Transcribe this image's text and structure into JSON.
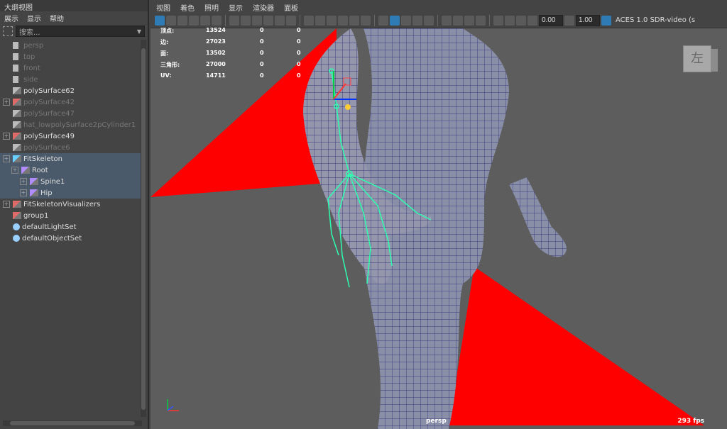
{
  "outliner": {
    "title": "大纲视图",
    "menus": [
      "展示",
      "显示",
      "帮助"
    ],
    "search_placeholder": "搜索...",
    "items": [
      {
        "label": "persp",
        "dim": true,
        "type": "camera",
        "indent": 0,
        "expand": false
      },
      {
        "label": "top",
        "dim": true,
        "type": "camera",
        "indent": 0,
        "expand": false
      },
      {
        "label": "front",
        "dim": true,
        "type": "camera",
        "indent": 0,
        "expand": false
      },
      {
        "label": "side",
        "dim": true,
        "type": "camera",
        "indent": 0,
        "expand": false
      },
      {
        "label": "polySurface62",
        "dim": false,
        "type": "mesh",
        "indent": 0,
        "expand": false
      },
      {
        "label": "polySurface42",
        "dim": true,
        "type": "mesh-group",
        "indent": 0,
        "expand": true
      },
      {
        "label": "polySurface47",
        "dim": true,
        "type": "mesh",
        "indent": 0,
        "expand": false
      },
      {
        "label": "hat_lowpolySurface2pCylinder1",
        "dim": true,
        "type": "mesh",
        "indent": 0,
        "expand": false
      },
      {
        "label": "polySurface49",
        "dim": false,
        "type": "mesh-group",
        "indent": 0,
        "expand": true
      },
      {
        "label": "polySurface6",
        "dim": true,
        "type": "mesh",
        "indent": 0,
        "expand": false
      },
      {
        "label": "FitSkeleton",
        "dim": false,
        "type": "curve",
        "indent": 0,
        "expand": true,
        "selected": true
      },
      {
        "label": "Root",
        "dim": false,
        "type": "joint",
        "indent": 1,
        "expand": true,
        "selected": true
      },
      {
        "label": "Spine1",
        "dim": false,
        "type": "joint",
        "indent": 2,
        "expand": true,
        "selected": true
      },
      {
        "label": "Hip",
        "dim": false,
        "type": "joint",
        "indent": 2,
        "expand": true,
        "selected": true
      },
      {
        "label": "FitSkeletonVisualizers",
        "dim": false,
        "type": "mesh-group",
        "indent": 0,
        "expand": true
      },
      {
        "label": "group1",
        "dim": false,
        "type": "mesh-group",
        "indent": 0,
        "expand": false
      },
      {
        "label": "defaultLightSet",
        "dim": false,
        "type": "set",
        "indent": 0,
        "expand": false
      },
      {
        "label": "defaultObjectSet",
        "dim": false,
        "type": "set",
        "indent": 0,
        "expand": false
      }
    ]
  },
  "viewport": {
    "menus": [
      "视图",
      "着色",
      "照明",
      "显示",
      "渲染器",
      "面板"
    ],
    "exposure": "0.00",
    "gamma": "1.00",
    "colorspace": "ACES 1.0 SDR-video (s",
    "hud": [
      {
        "label": "顶点:",
        "v1": "13524",
        "v2": "0",
        "v3": "0"
      },
      {
        "label": "边:",
        "v1": "27023",
        "v2": "0",
        "v3": "0"
      },
      {
        "label": "面:",
        "v1": "13502",
        "v2": "0",
        "v3": "0"
      },
      {
        "label": "三角形:",
        "v1": "27000",
        "v2": "0",
        "v3": "0"
      },
      {
        "label": "UV:",
        "v1": "14711",
        "v2": "0",
        "v3": "0"
      }
    ],
    "viewcube_label": "左",
    "camera": "persp",
    "fps": "293 fps",
    "colors": {
      "plane": "#ff0000",
      "mesh": "#8a8fa8",
      "wire": "#1c1c6e",
      "skeleton": "#2cffb0"
    }
  }
}
